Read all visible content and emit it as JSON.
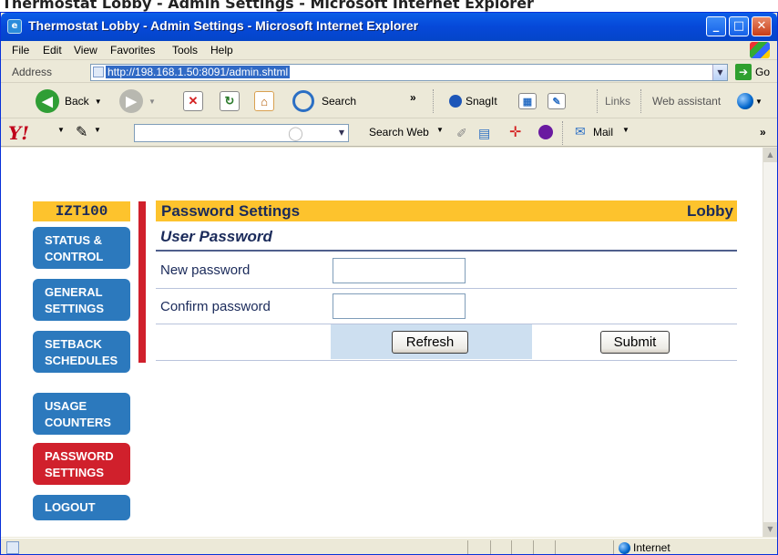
{
  "window": {
    "title": "Thermostat Lobby - Admin Settings - Microsoft Internet Explorer",
    "caption_buttons": [
      "minimize",
      "maximize",
      "close"
    ]
  },
  "menu": [
    "File",
    "Edit",
    "View",
    "Favorites",
    "Tools",
    "Help"
  ],
  "address": {
    "label": "Address",
    "url": "http://198.168.1.50:8091/admin.shtml",
    "go_label": "Go"
  },
  "toolbar": {
    "back_label": "Back",
    "search_label": "Search",
    "snagit_label": "SnagIt",
    "links_label": "Links",
    "assistant_label": "Web assistant",
    "chevron": "»"
  },
  "yahoo": {
    "logo": "Y!",
    "search_web_label": "Search Web",
    "mail_label": "Mail",
    "chevron": "»"
  },
  "nav": {
    "title": "IZT100",
    "items": [
      {
        "line1": "Status &",
        "line2": "Control",
        "active": false
      },
      {
        "line1": "General",
        "line2": "Settings",
        "active": false
      },
      {
        "line1": "Setback",
        "line2": "Schedules",
        "active": false
      },
      {
        "line1": "Usage",
        "line2": "Counters",
        "active": false
      },
      {
        "line1": "Password",
        "line2": "Settings",
        "active": true
      },
      {
        "line1": "Logout",
        "line2": "",
        "active": false
      }
    ]
  },
  "page": {
    "header": "Password Settings",
    "header_right": "Lobby",
    "section_title": "User Password",
    "fields": [
      {
        "label": "New password",
        "value": ""
      },
      {
        "label": "Confirm password",
        "value": ""
      }
    ],
    "refresh_label": "Refresh",
    "submit_label": "Submit"
  },
  "status": {
    "zone": "Internet"
  },
  "colors": {
    "accent_yellow": "#fdc32d",
    "nav_blue": "#2c79bd",
    "active_red": "#d0202c",
    "header_text": "#1a2a5a"
  }
}
